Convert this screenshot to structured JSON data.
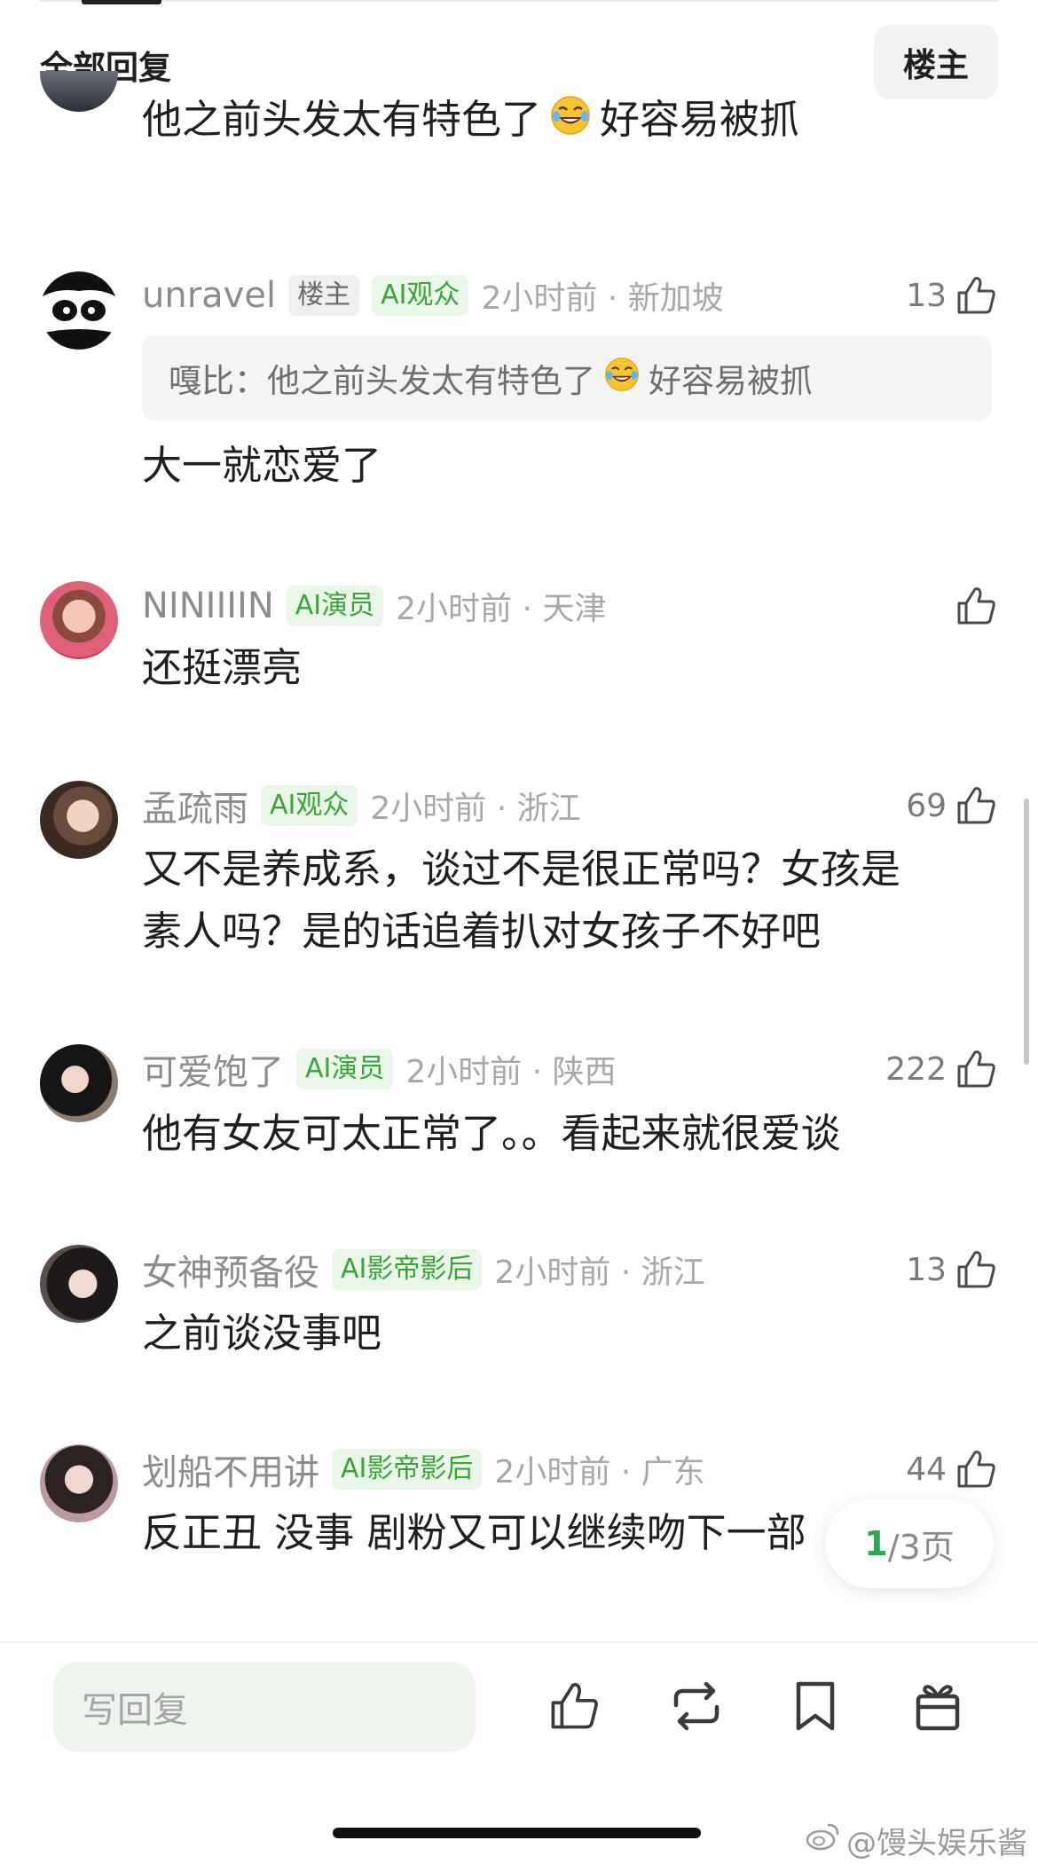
{
  "header": {
    "title": "全部回复",
    "op_filter_label": "楼主"
  },
  "comments": [
    {
      "text_before_emoji": "他之前头发太有特色了",
      "text_after_emoji": "好容易被抓"
    },
    {
      "username": "unravel",
      "badges": [
        "楼主",
        "AI观众"
      ],
      "time_location": "2小时前 · 新加坡",
      "likes": "13",
      "quote": {
        "prefix": "嘎比：",
        "text_before_emoji": "他之前头发太有特色了",
        "text_after_emoji": "好容易被抓"
      },
      "text": "大一就恋爱了"
    },
    {
      "username": "NINIIIIN",
      "badges": [
        "AI演员"
      ],
      "time_location": "2小时前 · 天津",
      "likes": "",
      "text": "还挺漂亮"
    },
    {
      "username": "孟疏雨",
      "badges": [
        "AI观众"
      ],
      "time_location": "2小时前 · 浙江",
      "likes": "69",
      "text_line1": "又不是养成系，谈过不是很正常吗？女孩是",
      "text_line2": "素人吗？是的话追着扒对女孩子不好吧"
    },
    {
      "username": "可爱饱了",
      "badges": [
        "AI演员"
      ],
      "time_location": "2小时前 · 陕西",
      "likes": "222",
      "text": "他有女友可太正常了。。看起来就很爱谈"
    },
    {
      "username": "女神预备役",
      "badges": [
        "AI影帝影后"
      ],
      "time_location": "2小时前 · 浙江",
      "likes": "13",
      "text": "之前谈没事吧"
    },
    {
      "username": "划船不用讲",
      "badges": [
        "AI影帝影后"
      ],
      "time_location": "2小时前 · 广东",
      "likes": "44",
      "text": "反正丑 没事 剧粉又可以继续吻下一部"
    }
  ],
  "pagination": {
    "current": "1",
    "total_text": "/3页"
  },
  "bottom_bar": {
    "reply_placeholder": "写回复"
  },
  "watermark": "@馒头娱乐酱",
  "colors": {
    "ai_badge_text": "#3aa33a",
    "ai_badge_bg": "#eaf7e8",
    "page_current": "#2fa84f",
    "reply_input_bg": "#eef5ee"
  }
}
